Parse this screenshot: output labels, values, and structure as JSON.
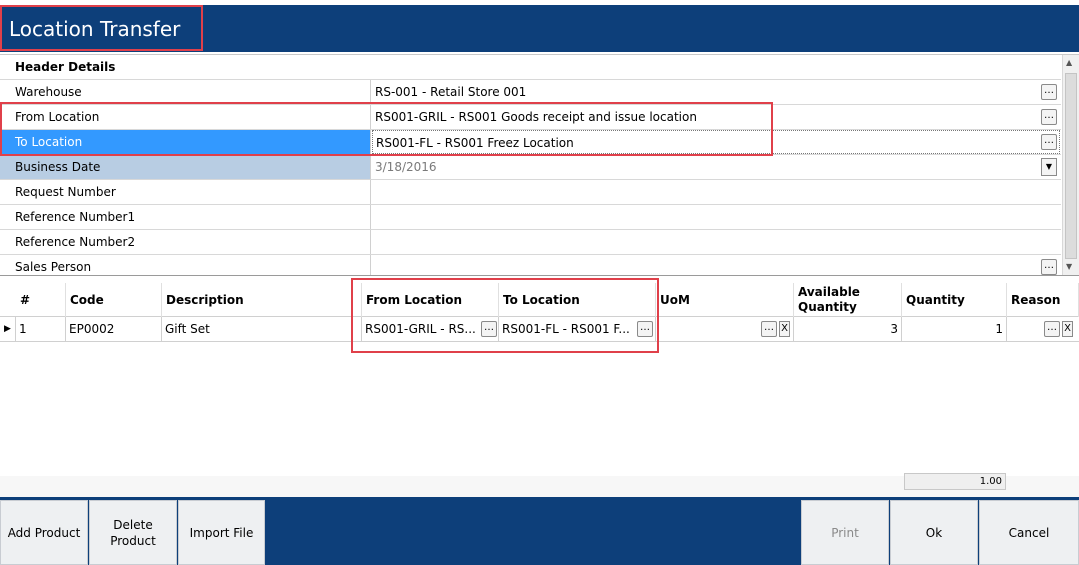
{
  "window": {
    "title": "Location Transfer"
  },
  "header": {
    "section_title": "Header Details",
    "fields": [
      {
        "label": "Warehouse",
        "value": "RS-001 - Retail Store 001"
      },
      {
        "label": "From Location",
        "value": "RS001-GRIL - RS001 Goods receipt and issue location"
      },
      {
        "label": "To Location",
        "value": "RS001-FL - RS001 Freez Location"
      },
      {
        "label": "Business Date",
        "value": "3/18/2016"
      },
      {
        "label": "Request Number",
        "value": ""
      },
      {
        "label": "Reference Number1",
        "value": ""
      },
      {
        "label": "Reference Number2",
        "value": ""
      },
      {
        "label": "Sales Person",
        "value": ""
      }
    ]
  },
  "grid": {
    "columns": [
      "#",
      "Code",
      "Description",
      "From Location",
      "To Location",
      "UoM",
      "Available Quantity",
      "Quantity",
      "Reason"
    ],
    "rows": [
      {
        "num": "1",
        "code": "EP0002",
        "description": "Gift Set",
        "from_location": "RS001-GRIL - RS...",
        "to_location": "RS001-FL - RS001 F...",
        "uom": "",
        "available_quantity": "3",
        "quantity": "1",
        "reason": ""
      }
    ],
    "total": "1.00"
  },
  "footer": {
    "add_product": "Add  Product",
    "delete_product": "Delete Product",
    "import_file": "Import File",
    "print": "Print",
    "ok": "Ok",
    "cancel": "Cancel"
  },
  "icons": {
    "ellipsis": "…",
    "dropdown": "▼",
    "clear": "X",
    "row_indicator": "▶"
  },
  "colors": {
    "brand_blue": "#0d3f7a",
    "selection_blue": "#3399ff",
    "highlight_red": "#e0404a"
  }
}
